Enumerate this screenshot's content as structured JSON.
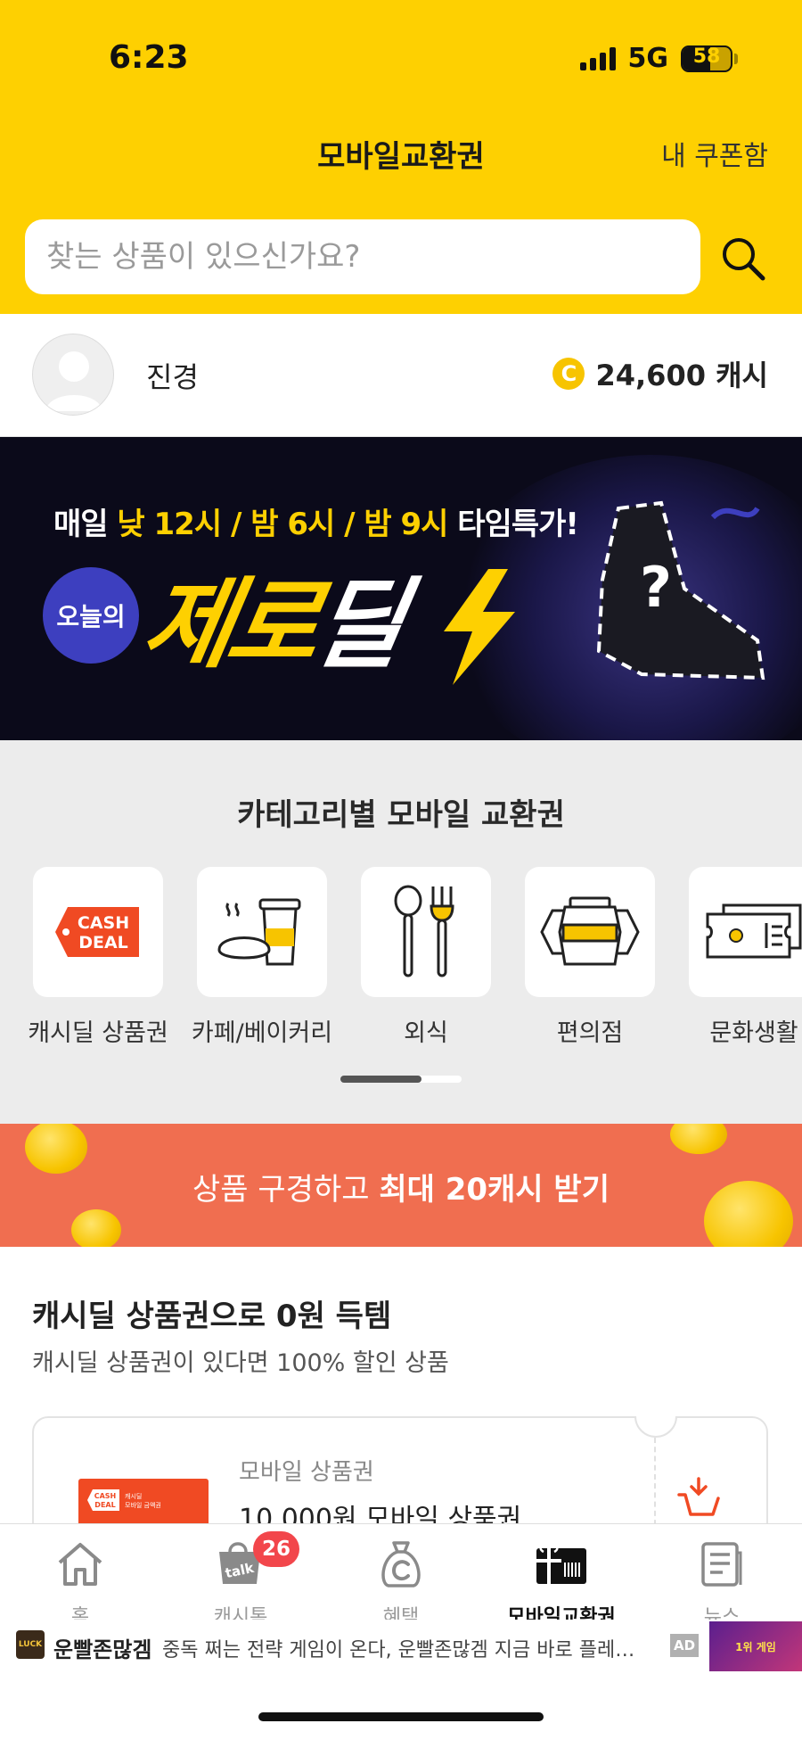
{
  "status_bar": {
    "time": "6:23",
    "network": "5G",
    "battery": "58",
    "battery_level": 0.58
  },
  "header": {
    "title": "모바일교환권",
    "my_coupons": "내 쿠폰함"
  },
  "search": {
    "placeholder": "찾는 상품이 있으신가요?"
  },
  "profile": {
    "name": "진경",
    "coin_symbol": "C",
    "cash": "24,600 캐시"
  },
  "banner": {
    "line_prefix": "매일 ",
    "line_highlight": "낮 12시 / 밤 6시 / 밤 9시",
    "line_suffix": " 타임특가!",
    "badge": "오늘의",
    "title_part1": "제로",
    "title_part2": "딜",
    "mystery": "?"
  },
  "category": {
    "title": "카테고리별 모바일 교환권",
    "cashdeal_logo": [
      "CASH",
      "DEAL"
    ],
    "items": [
      {
        "label": "캐시딜 상품권",
        "icon": "cash-deal-tag-icon"
      },
      {
        "label": "카페/베이커리",
        "icon": "coffee-bread-icon"
      },
      {
        "label": "외식",
        "icon": "spoon-fork-icon"
      },
      {
        "label": "편의점",
        "icon": "convenience-store-jars-icon"
      },
      {
        "label": "문화생활",
        "icon": "ticket-icon"
      }
    ],
    "scroll_progress": 0.67
  },
  "promo": {
    "text_prefix": "상품 구경하고 ",
    "text_bold": "최대 20캐시 받기"
  },
  "section": {
    "title": "캐시딜 상품권으로 0원 득템",
    "subtitle": "캐시딜 상품권이 있다면 100% 할인 상품",
    "coupon": {
      "category": "모바일 상품권",
      "name": "10,000원 모바일 상품권",
      "thumb_logo": [
        "CASH",
        "DEAL"
      ],
      "thumb_caption": [
        "캐시딜",
        "모바일 금액권"
      ]
    }
  },
  "tabbar": {
    "items": [
      {
        "label": "홈",
        "icon": "home-icon"
      },
      {
        "label": "캐시톡",
        "icon": "talk-bag-icon",
        "badge": "26",
        "icon_text": "talk"
      },
      {
        "label": "혜택",
        "icon": "coin-pouch-icon"
      },
      {
        "label": "모바일교환권",
        "icon": "gift-voucher-icon",
        "active": true
      },
      {
        "label": "뉴스",
        "icon": "news-icon"
      }
    ]
  },
  "ad": {
    "logo_text": "LUCK",
    "title": "운빨존많겜",
    "desc": "중독 쩌는 전략 게임이 온다, 운빨존많겜 지금 바로 플레이하세요",
    "tag": "AD",
    "thumb_text": "1위 게임"
  },
  "colors": {
    "brand_yellow": "#FED001",
    "promo": "#F06E50",
    "badge": "#F2464B",
    "cashdeal_red": "#F04A23"
  }
}
